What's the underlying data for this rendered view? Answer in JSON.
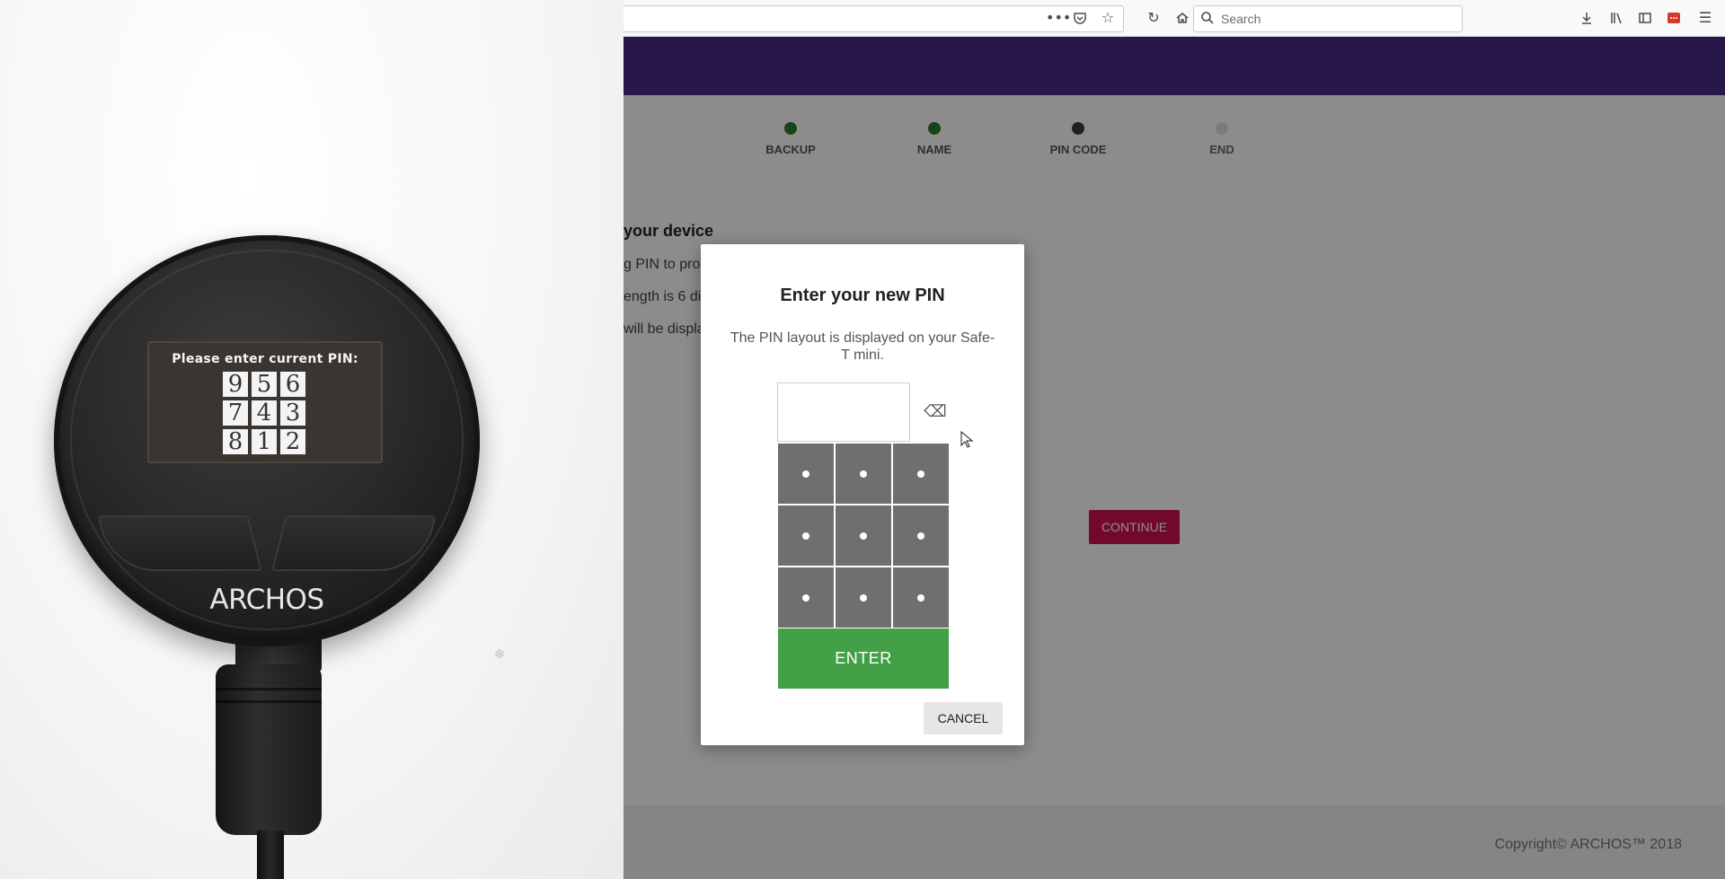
{
  "device_photo": {
    "screen_title": "Please enter current PIN:",
    "digits": [
      "9",
      "5",
      "6",
      "7",
      "4",
      "3",
      "8",
      "1",
      "2"
    ],
    "brand": "ARCHOS"
  },
  "browser": {
    "search_placeholder": "Search",
    "toolbar_icons_left": [
      "more-actions-icon",
      "pocket-icon",
      "bookmark-star-icon",
      "reload-icon",
      "home-icon"
    ],
    "toolbar_icons_right": [
      "download-icon",
      "library-icon",
      "sidebar-icon",
      "addon-icon",
      "menu-icon"
    ]
  },
  "page": {
    "header_color": "#4a2c86",
    "steps": [
      {
        "label": "BACKUP",
        "state": "done"
      },
      {
        "label": "NAME",
        "state": "done"
      },
      {
        "label": "PIN CODE",
        "state": "current"
      },
      {
        "label": "END",
        "state": "todo"
      }
    ],
    "setup_title": "your device",
    "setup_lines": [
      "g PIN to prot",
      "ength is 6 di",
      "will be displa"
    ],
    "continue_label": "CONTINUE",
    "footer_copyright": "Copyright© ARCHOS™ 2018"
  },
  "modal": {
    "title": "Enter your new PIN",
    "description": "The PIN layout is displayed on your Safe-T mini.",
    "enter_label": "ENTER",
    "cancel_label": "CANCEL",
    "accent_enter": "#43a047",
    "keypad_color": "#6f6f6f"
  }
}
